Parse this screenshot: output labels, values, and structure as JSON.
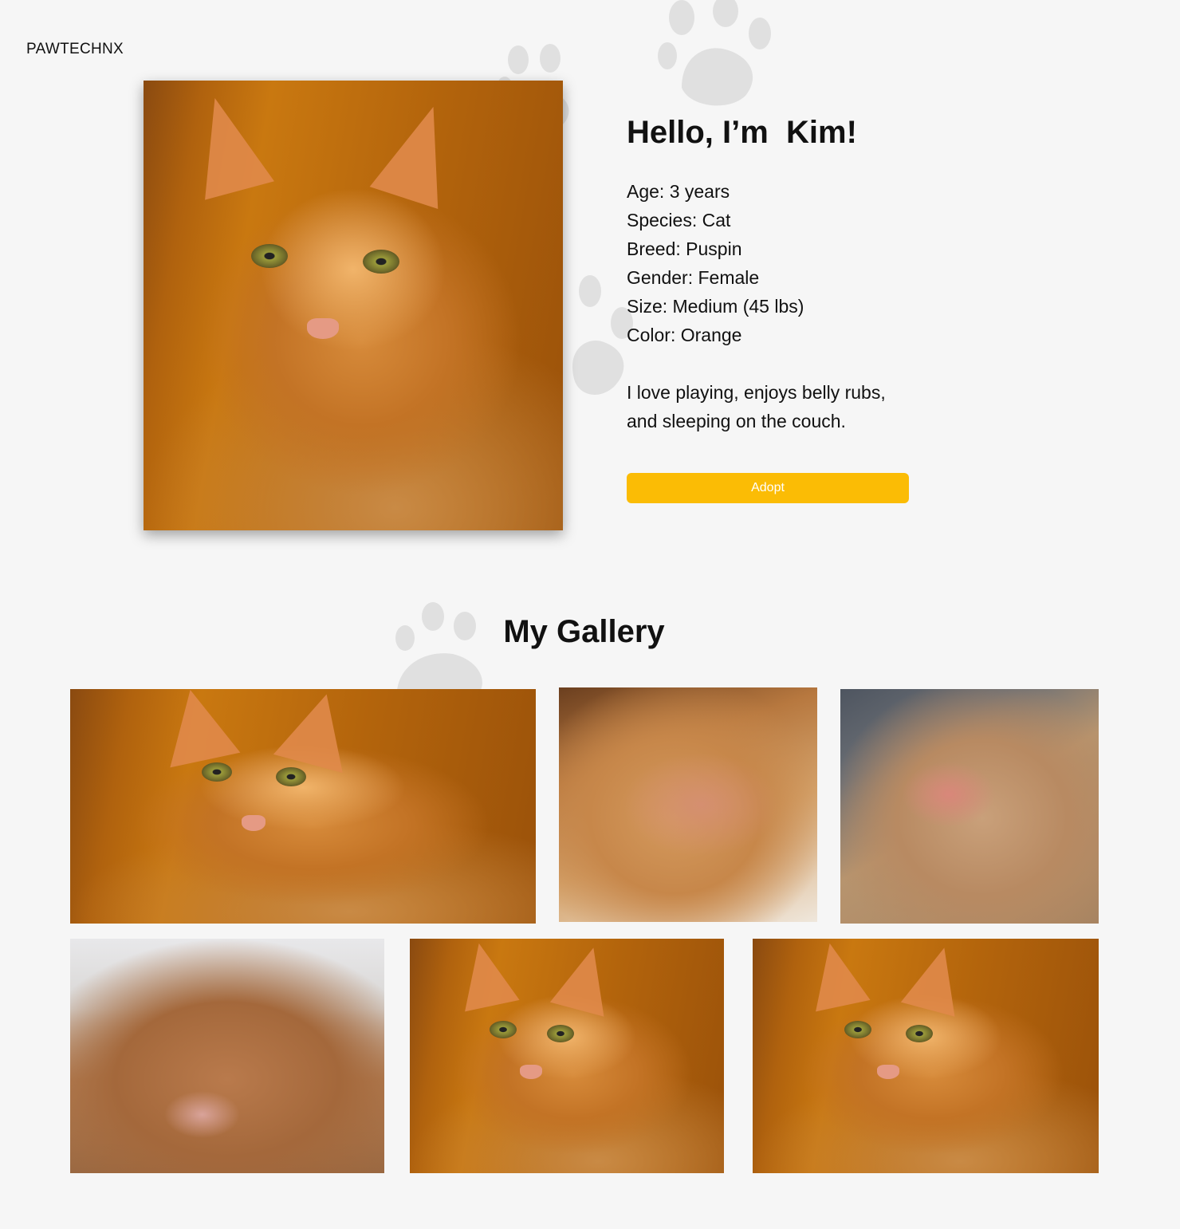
{
  "brand": {
    "name": "PAWTECHNX"
  },
  "profile": {
    "greeting": "Hello, I’m  Kim!",
    "facts": [
      "Age: 3 years",
      "Species: Cat",
      "Breed: Puspin",
      "Gender: Female",
      "Size: Medium (45 lbs)",
      "Color: Orange"
    ],
    "bio_lines": [
      "I love playing, enjoys belly rubs,",
      "and sleeping on the couch."
    ],
    "adopt_label": "Adopt"
  },
  "gallery": {
    "title": "My Gallery"
  },
  "colors": {
    "background": "#f6f6f6",
    "accent": "#fbbc05",
    "text": "#111111"
  },
  "icons": {
    "watermark": "paw-print-icon"
  }
}
